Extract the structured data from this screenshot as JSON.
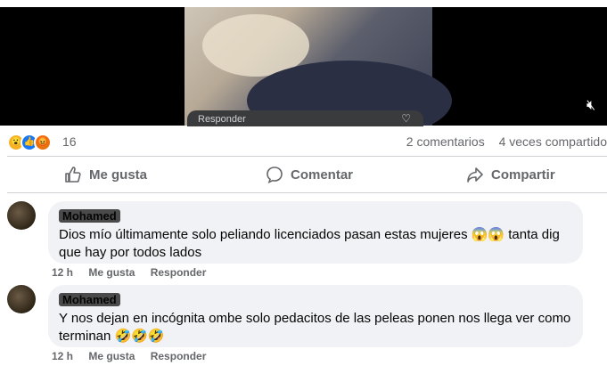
{
  "video": {
    "mini_reply_label": "Responder",
    "heart_icon": "heart-icon",
    "mute_icon": "speaker-mute-icon"
  },
  "stats": {
    "reaction_icons": [
      "wow-emoji",
      "like-emoji",
      "angry-emoji"
    ],
    "reaction_count": "16",
    "comments": "2 comentarios",
    "shares": "4 veces compartido"
  },
  "actions": {
    "like": "Me gusta",
    "comment": "Comentar",
    "share": "Compartir"
  },
  "comments": [
    {
      "author": "Mohamed",
      "text": "Dios mío últimamente solo peliando licenciados pasan estas mujeres 😱😱 tanta dig que hay por todos lados",
      "time": "12 h",
      "like": "Me gusta",
      "reply": "Responder"
    },
    {
      "author": "Mohamed",
      "text": "Y nos dejan en incógnita ombe solo pedacitos de las peleas ponen nos llega ver como terminan 🤣🤣🤣",
      "time": "12 h",
      "like": "Me gusta",
      "reply": "Responder"
    }
  ]
}
